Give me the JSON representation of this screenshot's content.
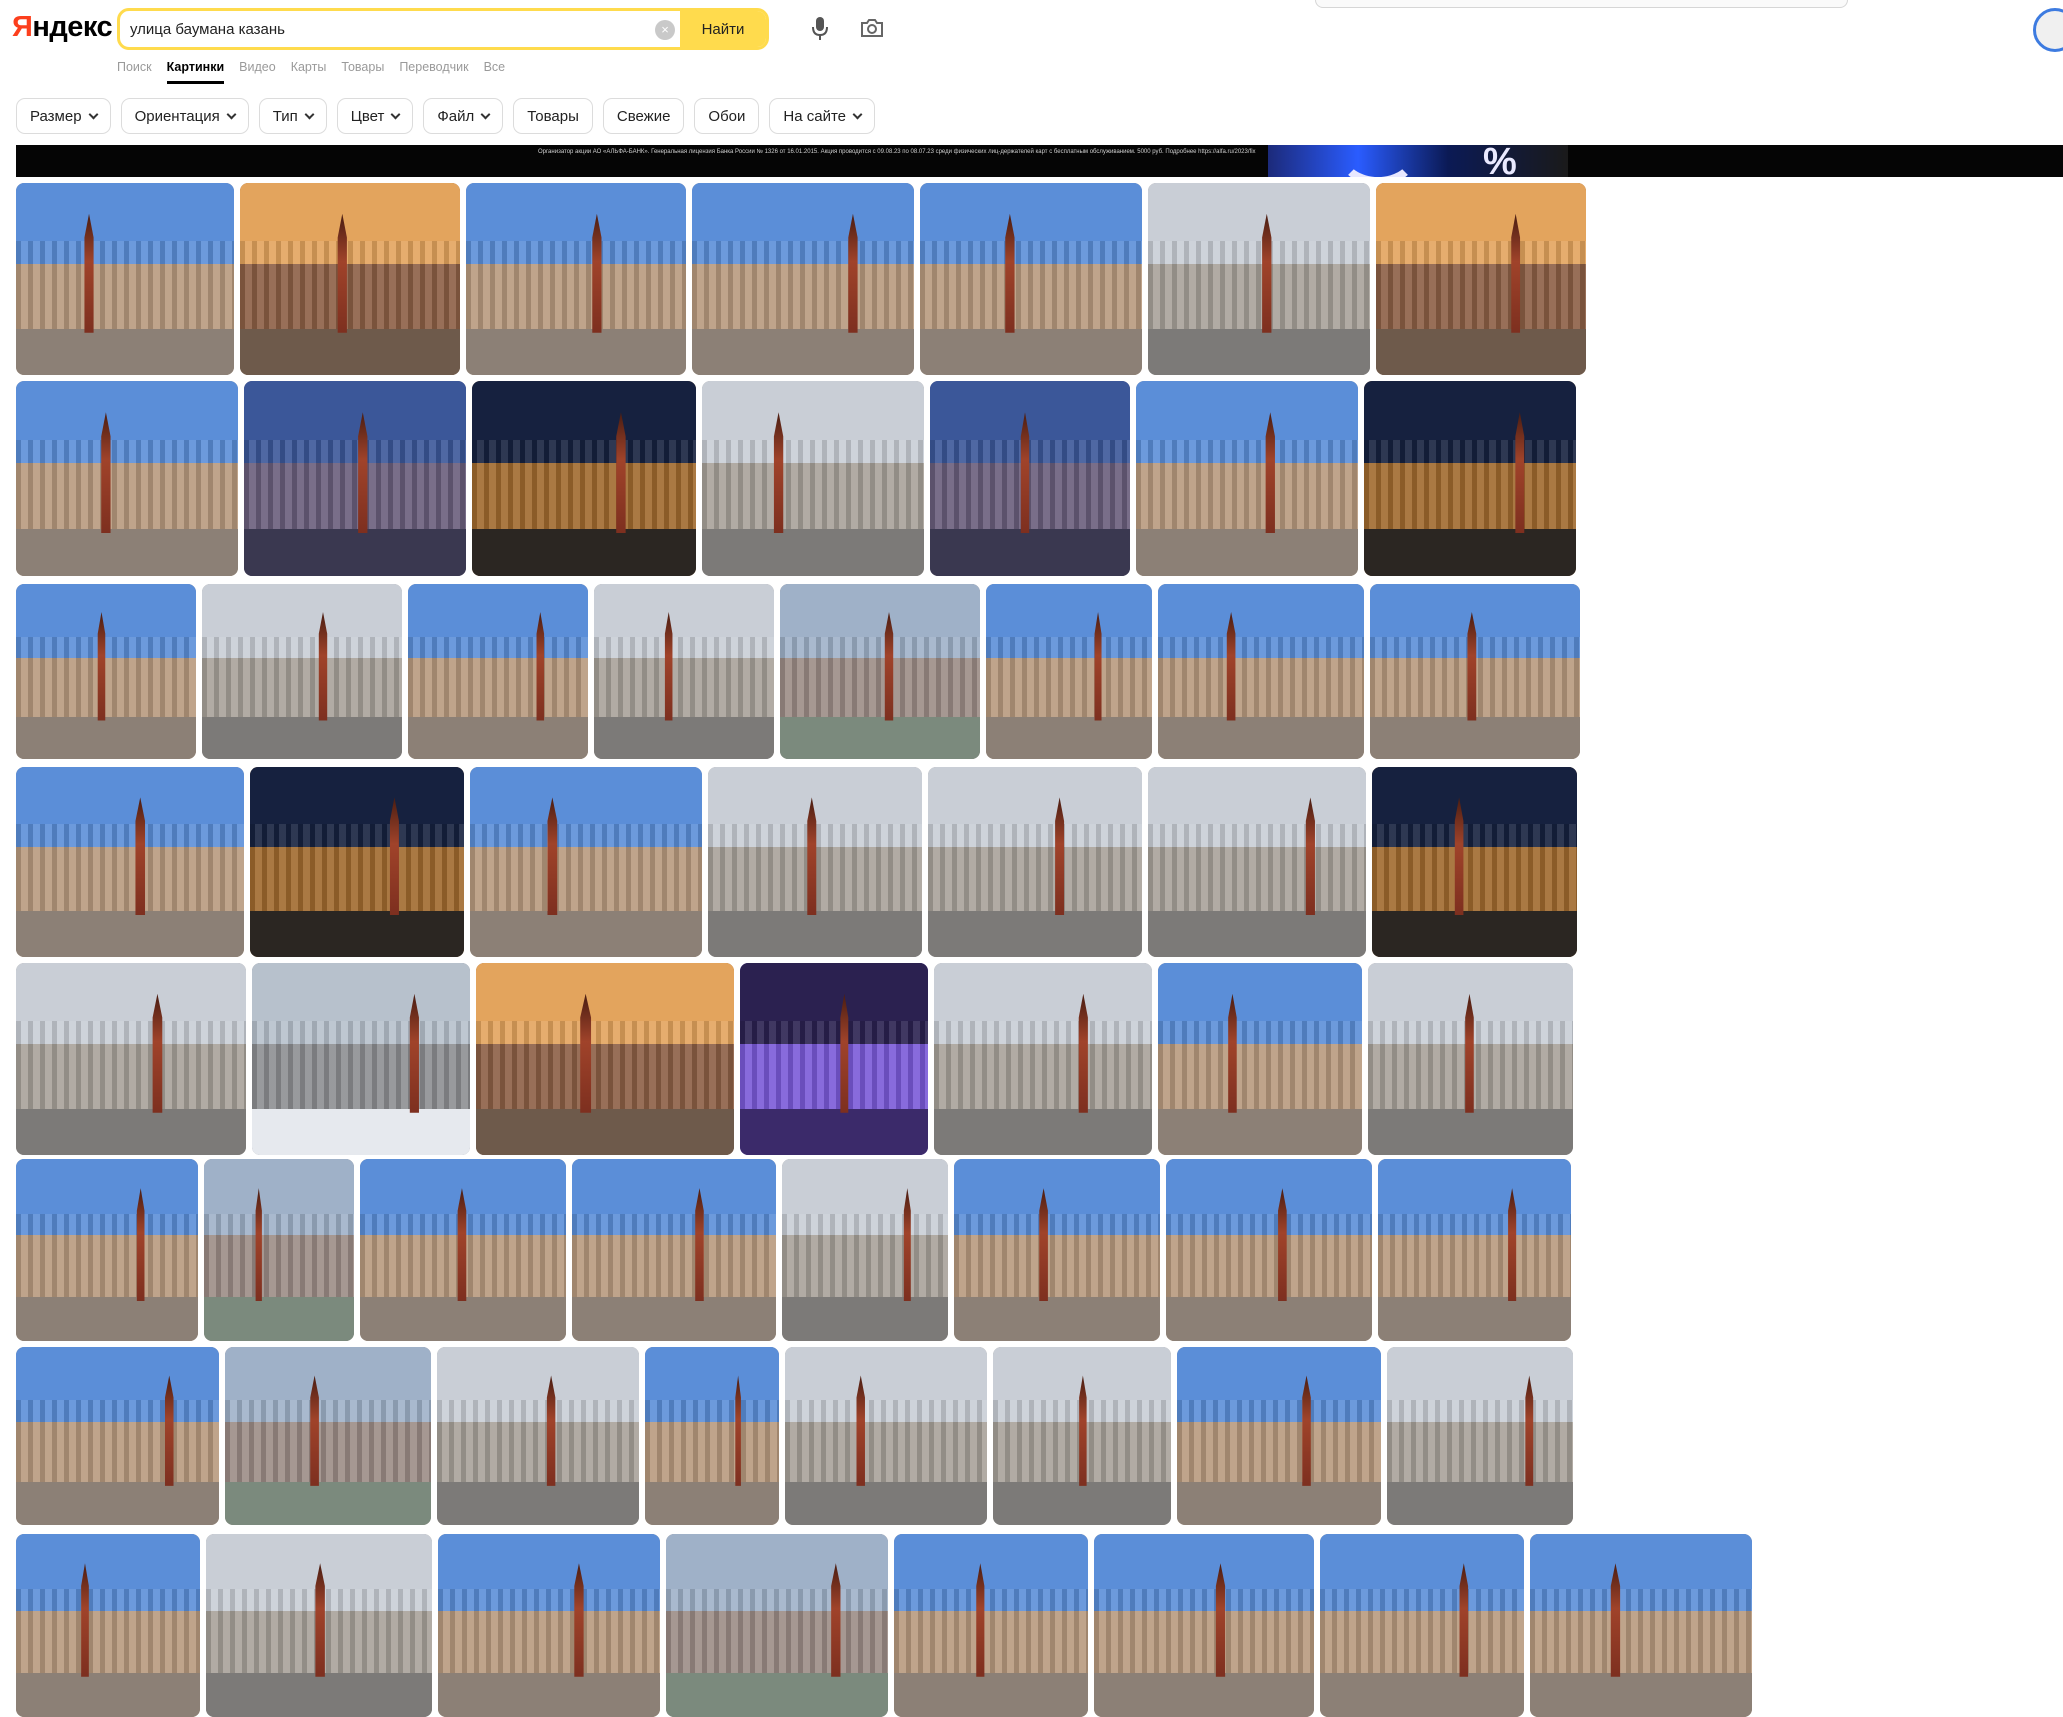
{
  "logo": {
    "first_letter": "Я",
    "rest": "ндекс"
  },
  "search": {
    "query": "улица баумана казань",
    "button_label": "Найти",
    "clear_symbol": "×"
  },
  "nav_tabs": [
    {
      "label": "Поиск",
      "active": false
    },
    {
      "label": "Картинки",
      "active": true
    },
    {
      "label": "Видео",
      "active": false
    },
    {
      "label": "Карты",
      "active": false
    },
    {
      "label": "Товары",
      "active": false
    },
    {
      "label": "Переводчик",
      "active": false
    },
    {
      "label": "Все",
      "active": false
    }
  ],
  "filters": [
    {
      "label": "Размер",
      "dropdown": true
    },
    {
      "label": "Ориентация",
      "dropdown": true
    },
    {
      "label": "Тип",
      "dropdown": true
    },
    {
      "label": "Цвет",
      "dropdown": true
    },
    {
      "label": "Файл",
      "dropdown": true
    },
    {
      "label": "Товары",
      "dropdown": false
    },
    {
      "label": "Свежие",
      "dropdown": false
    },
    {
      "label": "Обои",
      "dropdown": false
    },
    {
      "label": "На сайте",
      "dropdown": true
    }
  ],
  "ad": {
    "disclaimer": "Организатор акции АО «АЛЬФА-БАНК». Генеральная лицензия Банка России № 1326 от 16.01.2015. Акция проводится с 09.08.23 по 08.07.23 среди физических лиц-держателей карт с бесплатным обслуживанием. 5000 руб. Подробнее https://alfa.ru/2023/fix",
    "graphic_text": "%"
  },
  "rows": [
    [
      {
        "w": 218,
        "palette": "sunny"
      },
      {
        "w": 220,
        "palette": "sunset"
      },
      {
        "w": 220,
        "palette": "sunny"
      },
      {
        "w": 222,
        "palette": "sunny"
      },
      {
        "w": 222,
        "palette": "sunny"
      },
      {
        "w": 222,
        "palette": "grey"
      },
      {
        "w": 210,
        "palette": "sunset"
      }
    ],
    [
      {
        "w": 222,
        "palette": "sunny"
      },
      {
        "w": 222,
        "palette": "dusk"
      },
      {
        "w": 224,
        "palette": "night"
      },
      {
        "w": 222,
        "palette": "grey"
      },
      {
        "w": 200,
        "palette": "dusk"
      },
      {
        "w": 222,
        "palette": "sunny"
      },
      {
        "w": 212,
        "palette": "night"
      }
    ],
    [
      {
        "w": 180,
        "palette": "sunny"
      },
      {
        "w": 200,
        "palette": "grey"
      },
      {
        "w": 180,
        "palette": "sunny"
      },
      {
        "w": 180,
        "palette": "grey"
      },
      {
        "w": 200,
        "palette": "aerial"
      },
      {
        "w": 166,
        "palette": "sunny"
      },
      {
        "w": 206,
        "palette": "sunny"
      },
      {
        "w": 210,
        "palette": "sunny"
      }
    ],
    [
      {
        "w": 228,
        "palette": "sunny"
      },
      {
        "w": 214,
        "palette": "night"
      },
      {
        "w": 232,
        "palette": "sunny"
      },
      {
        "w": 214,
        "palette": "grey"
      },
      {
        "w": 214,
        "palette": "grey"
      },
      {
        "w": 218,
        "palette": "grey"
      },
      {
        "w": 205,
        "palette": "night"
      }
    ],
    [
      {
        "w": 230,
        "palette": "grey"
      },
      {
        "w": 218,
        "palette": "snow"
      },
      {
        "w": 258,
        "palette": "sunset"
      },
      {
        "w": 188,
        "palette": "purple"
      },
      {
        "w": 218,
        "palette": "grey"
      },
      {
        "w": 204,
        "palette": "sunny"
      },
      {
        "w": 205,
        "palette": "grey"
      }
    ],
    [
      {
        "w": 182,
        "palette": "sunny"
      },
      {
        "w": 150,
        "palette": "aerial"
      },
      {
        "w": 206,
        "palette": "sunny"
      },
      {
        "w": 204,
        "palette": "sunny"
      },
      {
        "w": 166,
        "palette": "grey"
      },
      {
        "w": 206,
        "palette": "sunny"
      },
      {
        "w": 206,
        "palette": "sunny"
      },
      {
        "w": 193,
        "palette": "sunny"
      }
    ],
    [
      {
        "w": 203,
        "palette": "sunny"
      },
      {
        "w": 206,
        "palette": "aerial"
      },
      {
        "w": 202,
        "palette": "grey"
      },
      {
        "w": 134,
        "palette": "sunny"
      },
      {
        "w": 202,
        "palette": "grey"
      },
      {
        "w": 178,
        "palette": "grey"
      },
      {
        "w": 204,
        "palette": "sunny"
      },
      {
        "w": 186,
        "palette": "grey"
      }
    ],
    [
      {
        "w": 184,
        "palette": "sunny"
      },
      {
        "w": 226,
        "palette": "grey"
      },
      {
        "w": 222,
        "palette": "sunny"
      },
      {
        "w": 222,
        "palette": "aerial"
      },
      {
        "w": 194,
        "palette": "sunny"
      },
      {
        "w": 220,
        "palette": "sunny"
      },
      {
        "w": 204,
        "palette": "sunny"
      },
      {
        "w": 222,
        "palette": "sunny"
      }
    ]
  ],
  "palettes": {
    "sunny": {
      "sky": "#5b8ed8",
      "bld": "#b89a7e",
      "ground": "#8c8076"
    },
    "sunset": {
      "sky": "#e3a45d",
      "bld": "#8c5f45",
      "ground": "#6e5a4b"
    },
    "grey": {
      "sky": "#c9ced6",
      "bld": "#a8a29a",
      "ground": "#7c7a78"
    },
    "dusk": {
      "sky": "#3b5799",
      "bld": "#6a5e7c",
      "ground": "#3a3850"
    },
    "night": {
      "sky": "#16213f",
      "bld": "#a06a2e",
      "ground": "#2b2622"
    },
    "aerial": {
      "sky": "#9fb1c8",
      "bld": "#9c8c86",
      "ground": "#7b8a7d"
    },
    "snow": {
      "sky": "#b7c1cc",
      "bld": "#8d8e92",
      "ground": "#e6e9ee"
    },
    "purple": {
      "sky": "#2b2150",
      "bld": "#7a5ad8",
      "ground": "#3b2a6a"
    }
  }
}
